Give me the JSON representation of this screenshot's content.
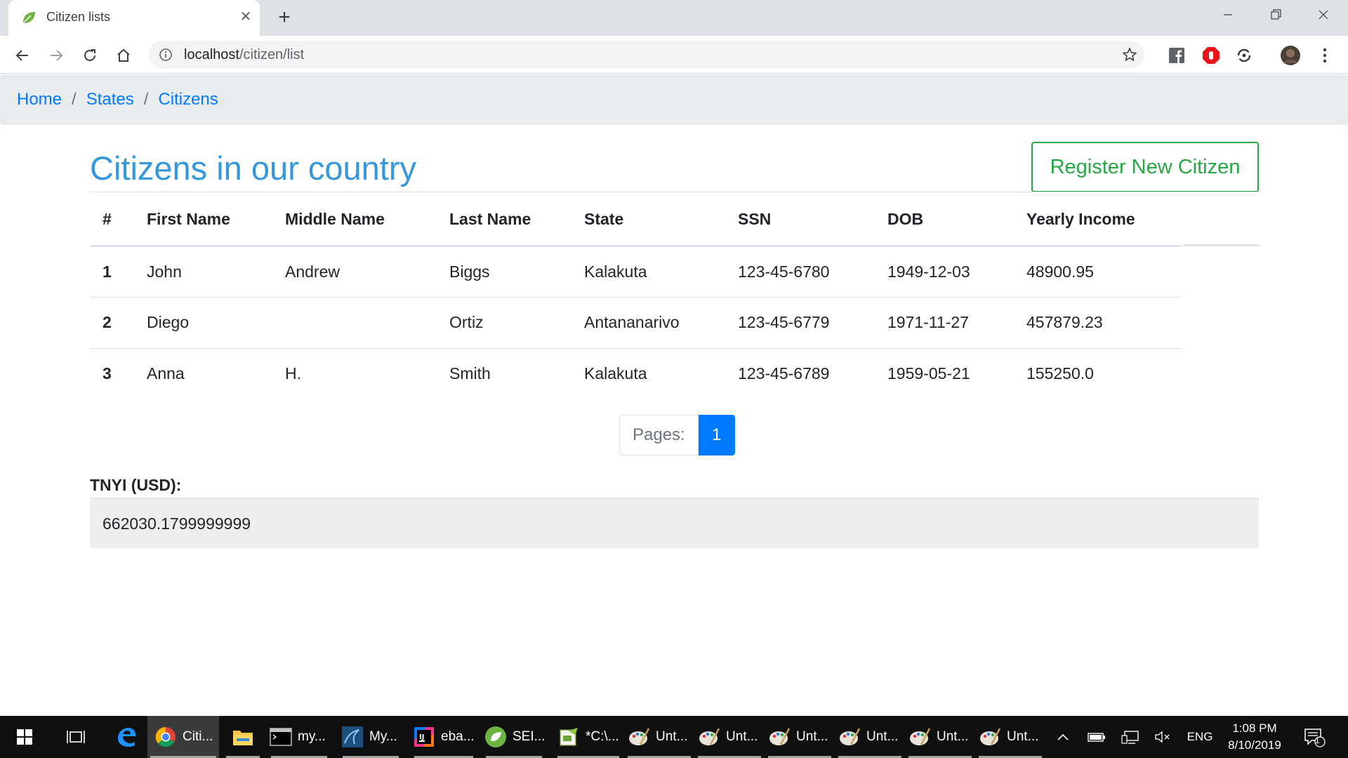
{
  "browser": {
    "tab_title": "Citizen lists",
    "url_host": "localhost",
    "url_path": "/citizen/list"
  },
  "breadcrumb": {
    "items": [
      "Home",
      "States",
      "Citizens"
    ],
    "separator": "/"
  },
  "page": {
    "title": "Citizens in our country",
    "register_label": "Register New Citizen"
  },
  "table": {
    "headers": [
      "#",
      "First Name",
      "Middle Name",
      "Last Name",
      "State",
      "SSN",
      "DOB",
      "Yearly Income"
    ],
    "rows": [
      [
        "1",
        "John",
        "Andrew",
        "Biggs",
        "Kalakuta",
        "123-45-6780",
        "1949-12-03",
        "48900.95"
      ],
      [
        "2",
        "Diego",
        "",
        "Ortiz",
        "Antananarivo",
        "123-45-6779",
        "1971-11-27",
        "457879.23"
      ],
      [
        "3",
        "Anna",
        "H.",
        "Smith",
        "Kalakuta",
        "123-45-6789",
        "1959-05-21",
        "155250.0"
      ]
    ]
  },
  "pagination": {
    "label": "Pages:",
    "current": "1"
  },
  "tnyi": {
    "label": "TNYI (USD):",
    "value": "662030.1799999999"
  },
  "taskbar": {
    "items": [
      {
        "name": "chrome",
        "label": "Citi..."
      },
      {
        "name": "file-explorer",
        "label": ""
      },
      {
        "name": "terminal",
        "label": "my..."
      },
      {
        "name": "mysql-workbench",
        "label": "My..."
      },
      {
        "name": "intellij",
        "label": "eba..."
      },
      {
        "name": "spring-tools",
        "label": "SEI..."
      },
      {
        "name": "notepad-plus",
        "label": "*C:\\..."
      },
      {
        "name": "paint-1",
        "label": "Unt..."
      },
      {
        "name": "paint-2",
        "label": "Unt..."
      },
      {
        "name": "paint-3",
        "label": "Unt..."
      },
      {
        "name": "paint-4",
        "label": "Unt..."
      },
      {
        "name": "paint-5",
        "label": "Unt..."
      },
      {
        "name": "paint-6",
        "label": "Unt..."
      }
    ],
    "language": "ENG",
    "time": "1:08 PM",
    "date": "8/10/2019",
    "notification_count": "1"
  },
  "colors": {
    "link": "#007bff",
    "title": "#3498db",
    "register": "#28a745",
    "page_active": "#007bff"
  }
}
